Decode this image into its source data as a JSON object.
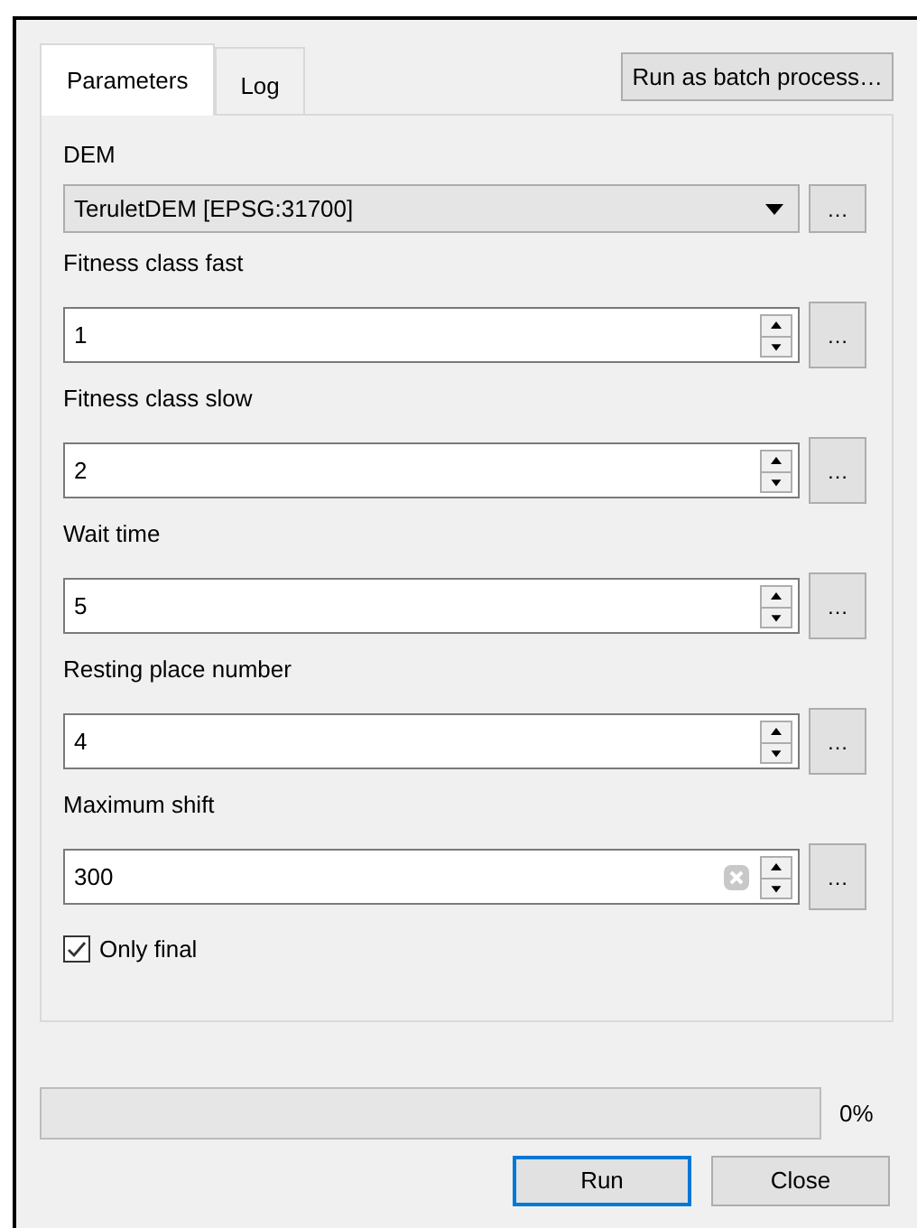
{
  "tabs": [
    {
      "label": "Parameters",
      "selected": true
    },
    {
      "label": "Log",
      "selected": false
    }
  ],
  "batch_button": "Run as batch process…",
  "parameters": [
    {
      "kind": "combo",
      "label": "DEM",
      "value": "TeruletDEM [EPSG:31700]",
      "more": "…"
    },
    {
      "kind": "spin",
      "label": "Fitness class fast",
      "value": "1",
      "clearable": false,
      "more": "…"
    },
    {
      "kind": "spin",
      "label": "Fitness class slow",
      "value": "2",
      "clearable": false,
      "more": "…"
    },
    {
      "kind": "spin",
      "label": "Wait time",
      "value": "5",
      "clearable": false,
      "more": "…"
    },
    {
      "kind": "spin",
      "label": "Resting place number",
      "value": "4",
      "clearable": false,
      "more": "…"
    },
    {
      "kind": "spin",
      "label": "Maximum shift",
      "value": "300",
      "clearable": true,
      "more": "…"
    }
  ],
  "only_final": {
    "label": "Only final",
    "checked": true
  },
  "progress": {
    "level": 0,
    "reading": "0%"
  },
  "buttons": [
    {
      "label": "Run",
      "selected": true
    },
    {
      "label": "Close",
      "selected": false
    }
  ]
}
